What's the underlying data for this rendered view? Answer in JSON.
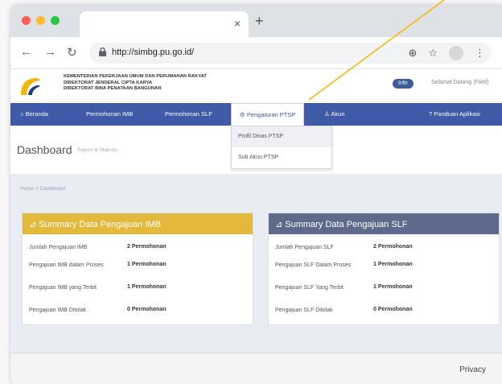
{
  "browser": {
    "tab_close": "×",
    "new_tab": "+",
    "url": "http://simbg.pu.go.id/",
    "colors": {
      "red": "#ff5f57",
      "yellow": "#febc2e",
      "green": "#28c840"
    }
  },
  "header": {
    "ministry_line1": "KEMENTERIAN PEKERJAAN UMUM DAN PERUMAHAN RAKYAT",
    "ministry_line2": "DIREKTORAT JENDERAL CIPTA KARYA",
    "ministry_line3": "DIREKTORAT BINA PENATAAN BANGUNAN",
    "info_label": "Info",
    "welcome_text": "Selamat Datang (Fiktif)"
  },
  "menu": {
    "beranda": "Beranda",
    "imb": "Permohonan IMB",
    "slf": "Permohonan SLF",
    "ptsp": "Pengaturan PTSP",
    "akun": "Akun",
    "panduan": "Panduan Aplikasi",
    "dropdown": [
      "Profil Dinas PTSP",
      "Sub Akun PTSP"
    ]
  },
  "page": {
    "title": "Dashboard",
    "subtitle": "Report & Statistic",
    "breadcrumb": "Home > Dashboard"
  },
  "imb": {
    "title": "Summary Data Pengajuan IMB",
    "color": "#e2b93b",
    "rows": [
      {
        "label": "Jumlah Pengajuan IMB",
        "value": "2 Permohonan"
      },
      {
        "label": "Pengajuan IMB dalam Proses",
        "value": "1 Permohonan"
      },
      {
        "label": "Pengajuan IMB yang Terbit",
        "value": "1 Permohonan"
      },
      {
        "label": "Pengajuan IMB Ditolak",
        "value": "0 Permohonan"
      }
    ]
  },
  "slf": {
    "title": "Summary Data Pengajuan SLF",
    "color": "#5d6a8c",
    "rows": [
      {
        "label": "Jumlah Pengajuan SLF",
        "value": "2 Permohonan"
      },
      {
        "label": "Pengajuan SLF Dalam Proses",
        "value": "1 Permohonan"
      },
      {
        "label": "Pengajuan SLF Yang Terbit",
        "value": "1 Permohonan"
      },
      {
        "label": "Pengajuan SLF Ditolak",
        "value": "0 Permohonan"
      }
    ]
  },
  "footer": {
    "privacy": "Privacy"
  },
  "annotation_color": "#f5b800",
  "menu_color": "#3f5aa6"
}
